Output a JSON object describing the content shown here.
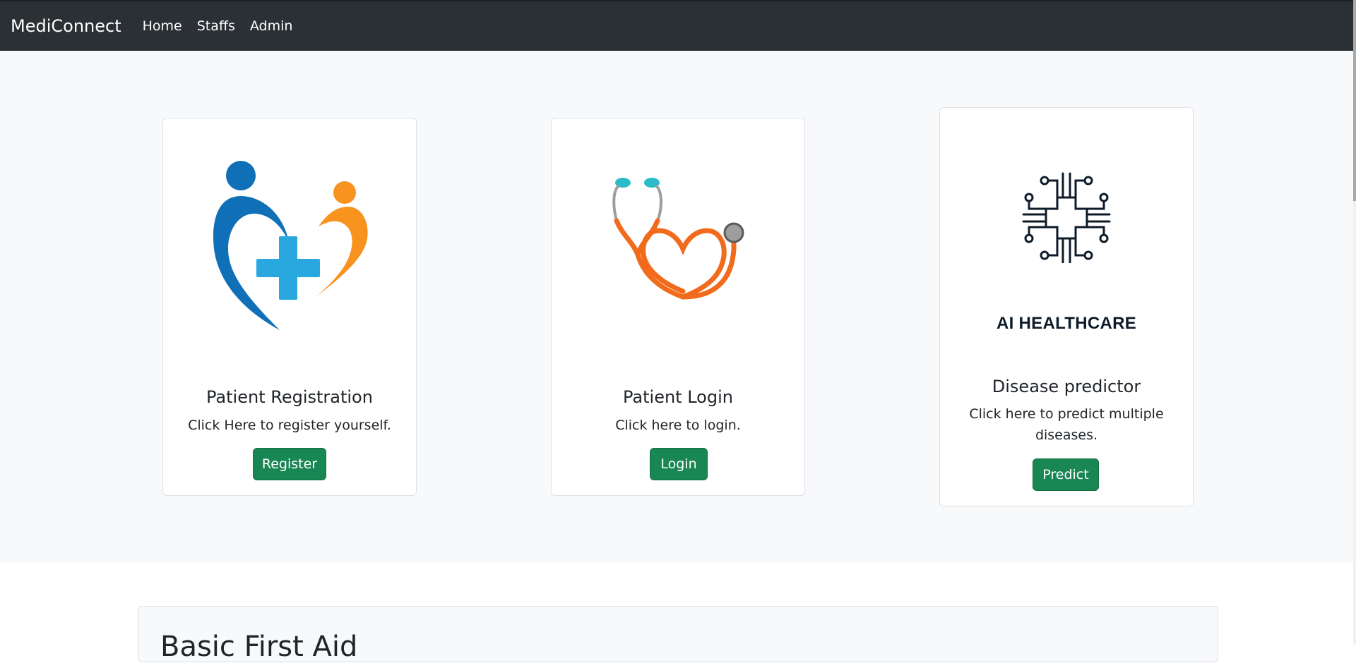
{
  "navbar": {
    "brand": "MediConnect",
    "links": [
      "Home",
      "Staffs",
      "Admin"
    ]
  },
  "cards": [
    {
      "title": "Patient Registration",
      "text": "Click Here to register yourself.",
      "button": "Register",
      "icon": "heart-people-cross-icon"
    },
    {
      "title": "Patient Login",
      "text": "Click here to login.",
      "button": "Login",
      "icon": "stethoscope-heart-icon"
    },
    {
      "title": "Disease predictor",
      "text": "Click here to predict multiple diseases.",
      "button": "Predict",
      "icon": "circuit-cross-icon",
      "logo_text": "AI HEALTHCARE"
    }
  ],
  "first_aid": {
    "title": "Basic First Aid"
  },
  "colors": {
    "navbar": "#2b3035",
    "button": "#198754",
    "hero_bg": "#f8f9fa",
    "logo_blue": "#0f6fb7",
    "logo_orange": "#f7931e",
    "logo_cross": "#29a8e0",
    "stethoscope": "#f26a1b",
    "stethoscope_tips": "#2bbcc9"
  }
}
